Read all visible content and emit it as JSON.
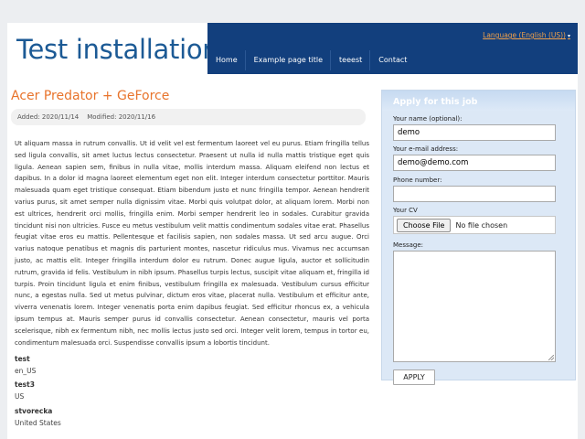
{
  "site": {
    "title": "Test installation"
  },
  "language": {
    "label": "Language (English (US))",
    "caret": "▾"
  },
  "menu": [
    {
      "label": "Home"
    },
    {
      "label": "Example page title"
    },
    {
      "label": "teeest"
    },
    {
      "label": "Contact"
    }
  ],
  "article": {
    "title": "Acer Predator + GeForce",
    "added": "Added: 2020/11/14",
    "modified": "Modified: 2020/11/16",
    "body": "Ut aliquam massa in rutrum convallis. Ut id velit vel est fermentum laoreet vel eu purus. Etiam fringilla tellus sed ligula convallis, sit amet luctus lectus consectetur. Praesent ut nulla id nulla mattis tristique eget quis ligula. Aenean sapien sem, finibus in nulla vitae, mollis interdum massa. Aliquam eleifend non lectus et dapibus. In a dolor id magna laoreet elementum eget non elit. Integer interdum consectetur porttitor. Mauris malesuada quam eget tristique consequat. Etiam bibendum justo et nunc fringilla tempor. Aenean hendrerit varius purus, sit amet semper nulla dignissim vitae. Morbi quis volutpat dolor, at aliquam lorem. Morbi non est ultrices, hendrerit orci mollis, fringilla enim. Morbi semper hendrerit leo in sodales. Curabitur gravida tincidunt nisi non ultricies. Fusce eu metus vestibulum velit mattis condimentum sodales vitae erat. Phasellus feugiat vitae eros eu mattis. Pellentesque et facilisis sapien, non sodales massa. Ut sed arcu augue. Orci varius natoque penatibus et magnis dis parturient montes, nascetur ridiculus mus. Vivamus nec accumsan justo, ac mattis elit. Integer fringilla interdum dolor eu rutrum. Donec augue ligula, auctor et sollicitudin rutrum, gravida id felis. Vestibulum in nibh ipsum. Phasellus turpis lectus, suscipit vitae aliquam et, fringilla id turpis. Proin tincidunt ligula et enim finibus, vestibulum fringilla ex malesuada. Vestibulum cursus efficitur nunc, a egestas nulla. Sed ut metus pulvinar, dictum eros vitae, placerat nulla. Vestibulum et efficitur ante, viverra venenatis lorem. Integer venenatis porta enim dapibus feugiat. Sed efficitur rhoncus ex, a vehicula ipsum tempus at. Mauris semper purus id convallis consectetur. Aenean consectetur, mauris vel porta scelerisque, nibh ex fermentum nibh, nec mollis lectus justo sed orci. Integer velit lorem, tempus in tortor eu, condimentum malesuada orci. Suspendisse convallis ipsum a lobortis tincidunt.",
    "fields": [
      {
        "label": "test",
        "value": "en_US"
      },
      {
        "label": "test3",
        "value": "US"
      },
      {
        "label": "stvorecka",
        "value": "United States"
      }
    ]
  },
  "apply_form": {
    "heading": "Apply for this job",
    "name_label": "Your name (optional):",
    "name_value": "demo",
    "email_label": "Your e-mail address:",
    "email_value": "demo@demo.com",
    "phone_label": "Phone number:",
    "phone_value": "",
    "cv_label": "Your CV",
    "choose_file_label": "Choose File",
    "file_status": "No file chosen",
    "message_label": "Message:",
    "submit_label": "APPLY"
  },
  "colors": {
    "brand_blue": "#1c5a95",
    "nav_background": "#123f7d",
    "accent_orange": "#e8742c",
    "panel_background": "#dce8f6"
  }
}
